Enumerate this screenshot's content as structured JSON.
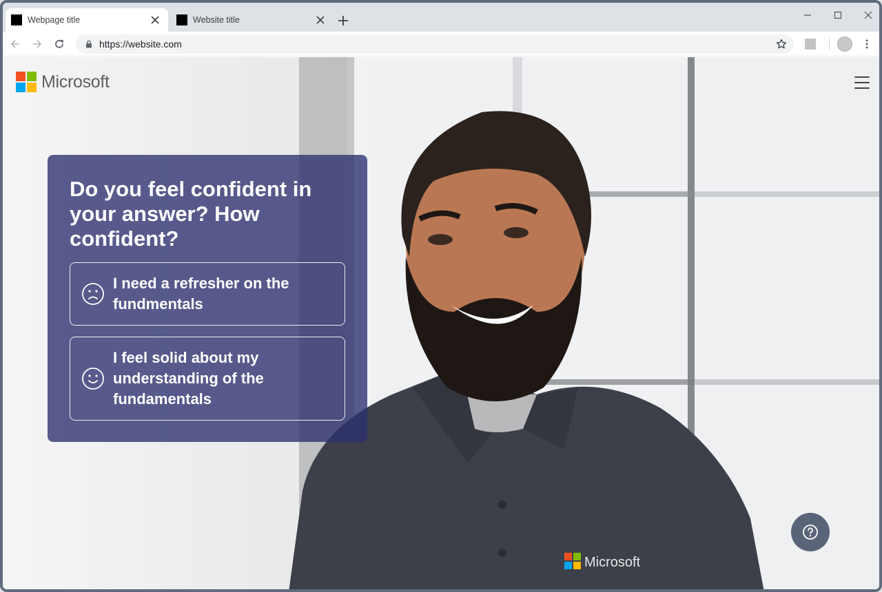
{
  "browser": {
    "tabs": [
      {
        "title": "Webpage title",
        "active": true
      },
      {
        "title": "Website title",
        "active": false
      }
    ],
    "url": "https://website.com"
  },
  "site": {
    "brand_name": "Microsoft",
    "logo_colors": [
      "#f25022",
      "#7fba00",
      "#00a4ef",
      "#ffb900"
    ],
    "shirt_brand": "Microsoft"
  },
  "quiz": {
    "question": "Do you feel confident in your answer? How confident?",
    "options": [
      {
        "label": "I need a refresher on the fundmentals",
        "icon": "sad-face-icon"
      },
      {
        "label": "I feel solid about my understanding of the fundamentals",
        "icon": "smile-face-icon"
      }
    ]
  },
  "colors": {
    "card": "#2c306e",
    "help_button": "#5a6478"
  }
}
